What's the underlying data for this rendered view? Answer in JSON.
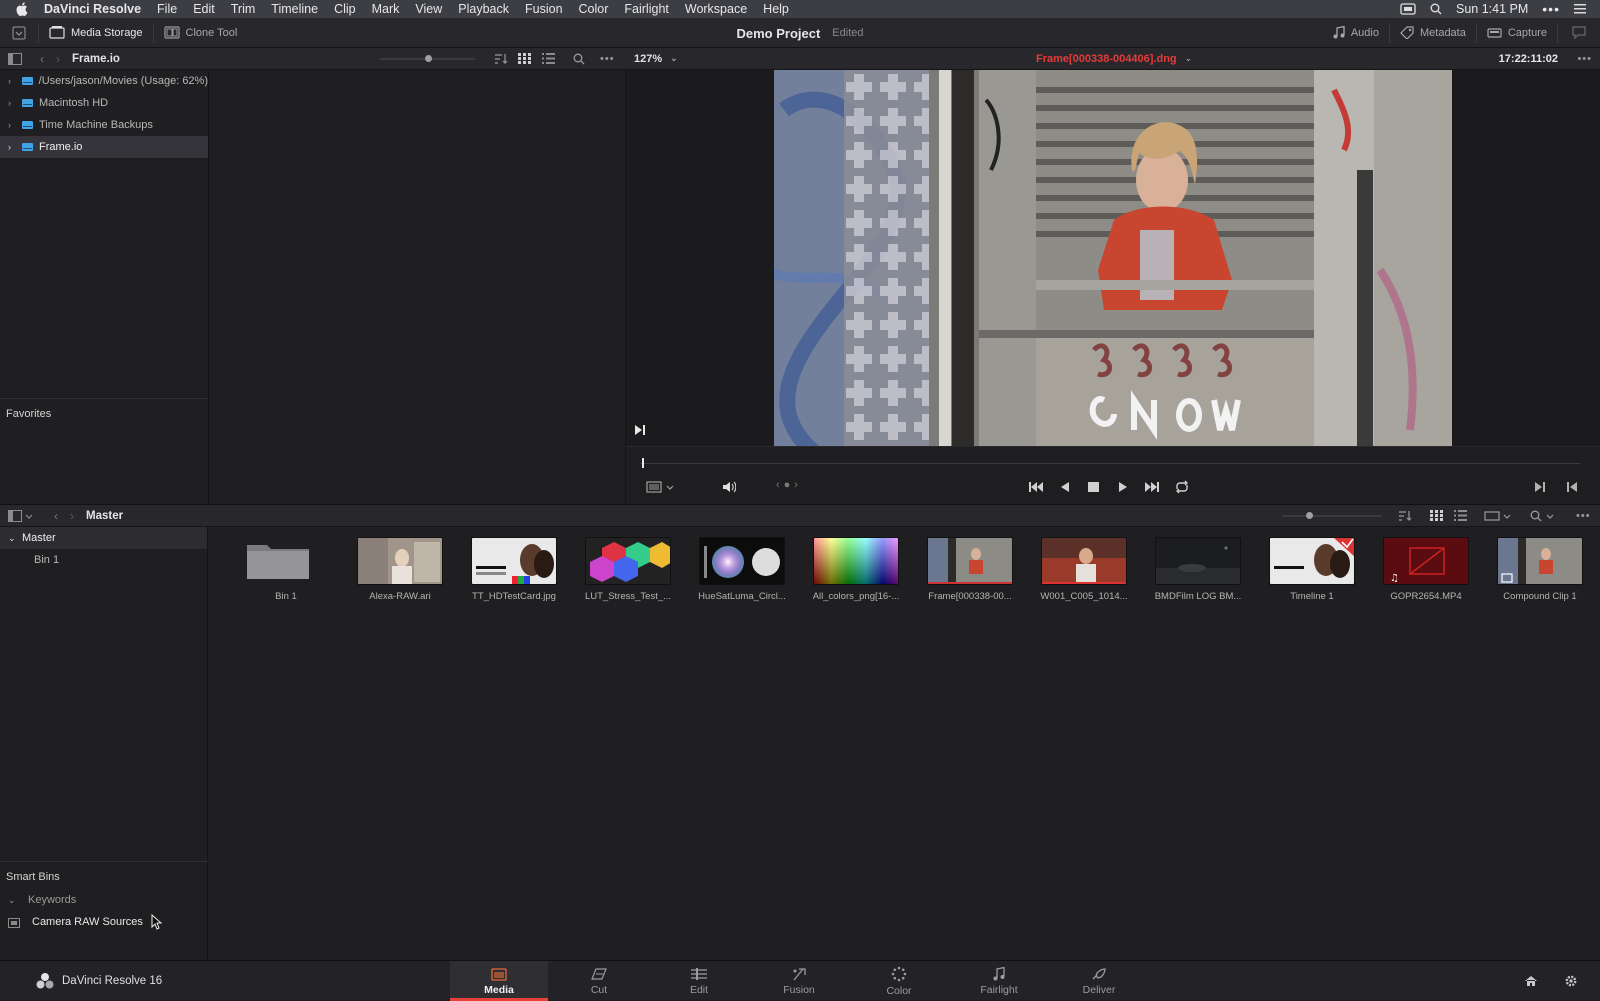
{
  "menubar": {
    "app": "DaVinci Resolve",
    "items": [
      "File",
      "Edit",
      "Trim",
      "Timeline",
      "Clip",
      "Mark",
      "View",
      "Playback",
      "Fusion",
      "Color",
      "Fairlight",
      "Workspace",
      "Help"
    ],
    "clock": "Sun 1:41 PM"
  },
  "toolbar": {
    "media_storage": "Media Storage",
    "clone_tool": "Clone Tool",
    "project_name": "Demo Project",
    "project_status": "Edited",
    "audio": "Audio",
    "metadata": "Metadata",
    "capture": "Capture"
  },
  "storage": {
    "location": "Frame.io",
    "items": [
      {
        "label": "/Users/jason/Movies (Usage: 62%)"
      },
      {
        "label": "Macintosh HD"
      },
      {
        "label": "Time Machine Backups"
      },
      {
        "label": "Frame.io",
        "selected": true
      }
    ],
    "favorites": "Favorites"
  },
  "viewer": {
    "zoom": "127%",
    "clip_name": "Frame[000338-004406].dng",
    "timecode": "17:22:11:02",
    "progress": 0.0
  },
  "pool": {
    "bin_title": "Master",
    "master": "Master",
    "bins": [
      "Bin 1"
    ],
    "smart_bins": "Smart Bins",
    "keywords": "Keywords",
    "camera_raw": "Camera RAW Sources",
    "clips": [
      {
        "name": "Bin 1",
        "kind": "folder"
      },
      {
        "name": "Alexa-RAW.ari",
        "kind": "alexa"
      },
      {
        "name": "TT_HDTestCard.jpg",
        "kind": "testcard"
      },
      {
        "name": "LUT_Stress_Test_...",
        "kind": "lut"
      },
      {
        "name": "HueSatLuma_Circl...",
        "kind": "hue"
      },
      {
        "name": "All_colors_png[16-...",
        "kind": "allcolors"
      },
      {
        "name": "Frame[000338-00...",
        "kind": "frame"
      },
      {
        "name": "W001_C005_1014...",
        "kind": "red"
      },
      {
        "name": "BMDFilm LOG BM...",
        "kind": "night"
      },
      {
        "name": "Timeline 1",
        "kind": "timeline"
      },
      {
        "name": "GOPR2654.MP4",
        "kind": "gopro"
      },
      {
        "name": "Compound Clip 1",
        "kind": "compound"
      }
    ]
  },
  "footer": {
    "app_version": "DaVinci Resolve 16",
    "pages": [
      "Media",
      "Cut",
      "Edit",
      "Fusion",
      "Color",
      "Fairlight",
      "Deliver"
    ]
  },
  "colors": {
    "accent_red": "#e8403a",
    "drive_blue": "#3fa3e6"
  }
}
